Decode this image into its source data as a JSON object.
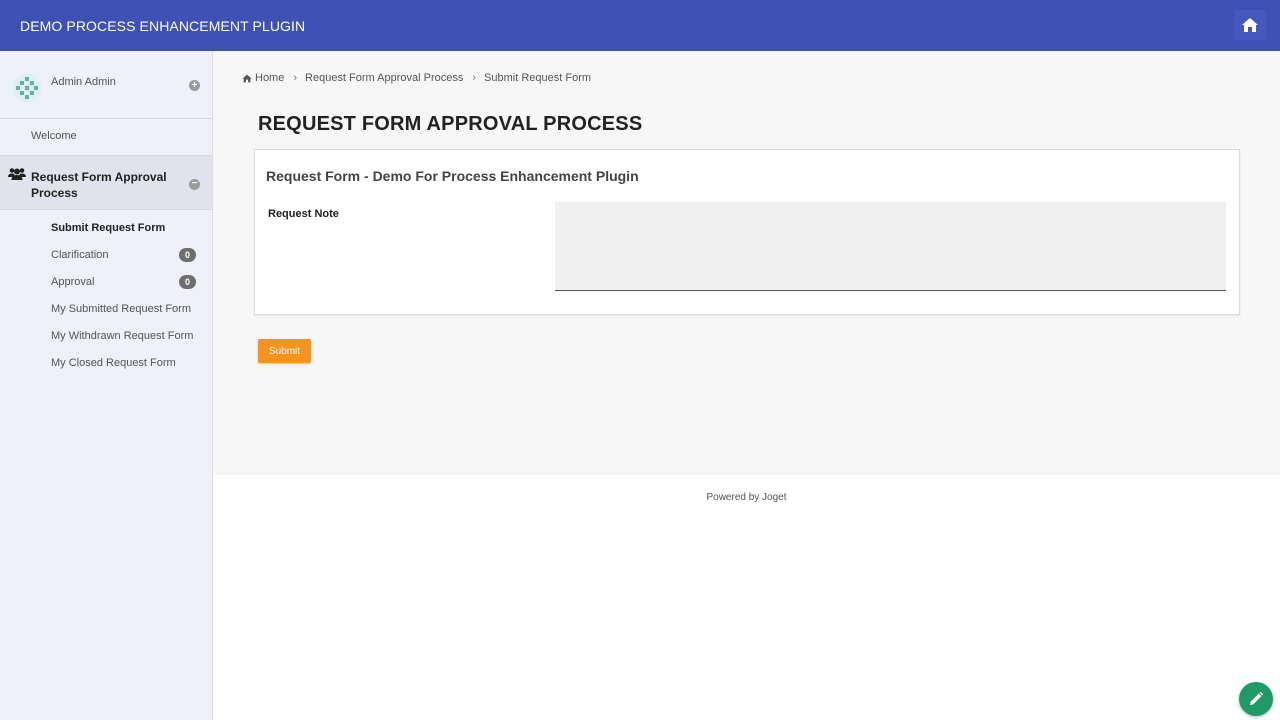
{
  "header": {
    "app_title": "DEMO PROCESS ENHANCEMENT PLUGIN",
    "home_icon": "home-icon"
  },
  "sidebar": {
    "profile": {
      "name": "Admin Admin",
      "toggle_symbol": "+"
    },
    "welcome_label": "Welcome",
    "category": {
      "label": "Request Form Approval Process",
      "icon": "users-icon",
      "toggle_symbol": "−"
    },
    "items": [
      {
        "label": "Submit Request Form",
        "active": true
      },
      {
        "label": "Clarification",
        "badge": "0"
      },
      {
        "label": "Approval",
        "badge": "0"
      },
      {
        "label": "My Submitted Request Form"
      },
      {
        "label": "My Withdrawn Request Form"
      },
      {
        "label": "My Closed Request Form"
      }
    ]
  },
  "breadcrumb": {
    "home_icon": "home-icon",
    "home": "Home",
    "process": "Request Form Approval Process",
    "current": "Submit Request Form"
  },
  "main": {
    "page_title": "REQUEST FORM APPROVAL PROCESS",
    "form": {
      "title": "Request Form - Demo For Process Enhancement Plugin",
      "fields": [
        {
          "label": "Request Note",
          "value": ""
        }
      ]
    },
    "submit_label": "Submit"
  },
  "footer": {
    "powered_by": "Powered by Joget"
  },
  "fab_icon": "pencil-icon",
  "colors": {
    "header_bg": "#3f51b5",
    "submit_bg": "#f7931e",
    "fab_bg": "#1f9a66",
    "sidebar_bg": "#eef0fa"
  }
}
